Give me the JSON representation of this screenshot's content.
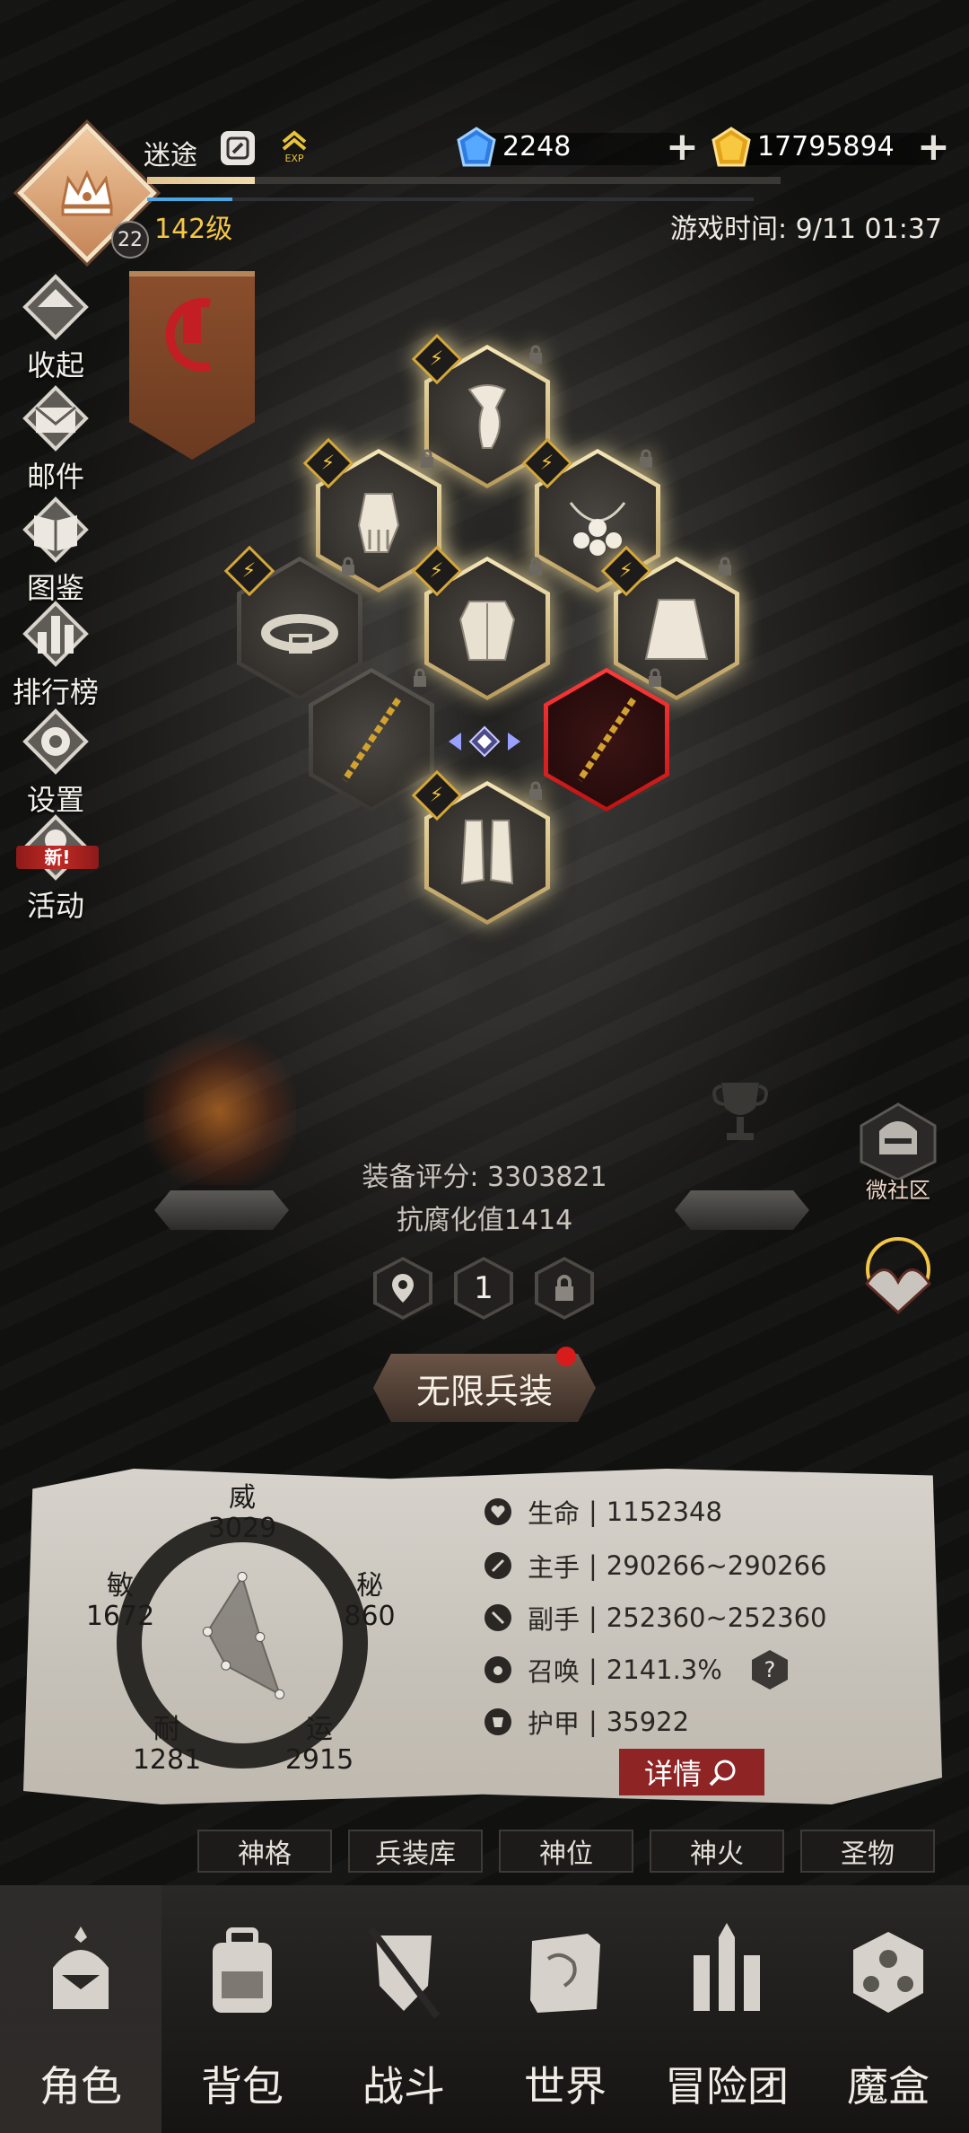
{
  "header": {
    "player_name": "迷途",
    "avatar_level": "22",
    "level_text": "142级",
    "exp_progress": 0.17,
    "secondary_progress": 0.14,
    "game_time": "游戏时间: 9/11 01:37",
    "diamonds": "2248",
    "gold": "17795894",
    "exp_icon_text": "EXP"
  },
  "side_menu": [
    {
      "label": "收起",
      "icon": "collapse-icon"
    },
    {
      "label": "邮件",
      "icon": "mail-icon"
    },
    {
      "label": "图鉴",
      "icon": "book-icon"
    },
    {
      "label": "排行榜",
      "icon": "ranking-icon"
    },
    {
      "label": "设置",
      "icon": "gear-icon"
    },
    {
      "label": "活动",
      "icon": "event-icon",
      "tag": "新!"
    }
  ],
  "equipment": {
    "score": "装备评分: 3303821",
    "corruption": "抗腐化值1414",
    "page_number": "1",
    "infinite_button": "无限兵装"
  },
  "right_buttons": {
    "community": "微社区"
  },
  "stats": {
    "wei": {
      "label": "威",
      "value": "3029"
    },
    "mi": {
      "label": "秘",
      "value": "860"
    },
    "min": {
      "label": "敏",
      "value": "1672"
    },
    "nai": {
      "label": "耐",
      "value": "1281"
    },
    "yun": {
      "label": "运",
      "value": "2915"
    },
    "attributes": [
      {
        "name": "生命",
        "value": "1152348"
      },
      {
        "name": "主手",
        "value": "290266~290266"
      },
      {
        "name": "副手",
        "value": "252360~252360"
      },
      {
        "name": "召唤",
        "value": "2141.3%"
      },
      {
        "name": "护甲",
        "value": "35922"
      }
    ],
    "separator": "|",
    "detail_button": "详情"
  },
  "tabs": [
    "神格",
    "兵装库",
    "神位",
    "神火",
    "圣物"
  ],
  "bottom_nav": [
    {
      "label": "角色",
      "icon": "helmet-icon"
    },
    {
      "label": "背包",
      "icon": "backpack-icon"
    },
    {
      "label": "战斗",
      "icon": "sword-shield-icon"
    },
    {
      "label": "世界",
      "icon": "map-icon"
    },
    {
      "label": "冒险团",
      "icon": "castle-icon"
    },
    {
      "label": "魔盒",
      "icon": "magic-box-icon"
    }
  ],
  "colors": {
    "gold_text": "#f5c845",
    "accent_red": "#8e2424",
    "exp_bar": "#e3c48f",
    "blue_bar": "#4aa7e3"
  }
}
